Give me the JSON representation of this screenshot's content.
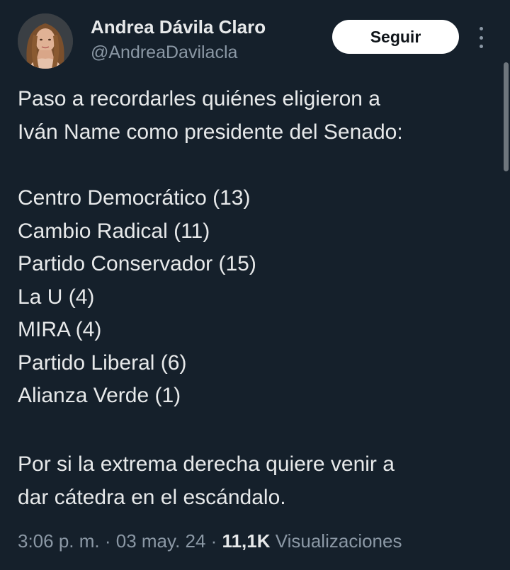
{
  "author": {
    "name": "Andrea Dávila Claro",
    "handle": "@AndreaDavilacla",
    "avatar_icon": "profile-photo"
  },
  "follow_button": {
    "label": "Seguir"
  },
  "more_icon": "more-vertical-icon",
  "tweet": {
    "intro_lines": [
      "Paso a recordarles quiénes eligieron a",
      "Iván Name como presidente del Senado:"
    ],
    "parties": [
      "Centro Democrático (13)",
      "Cambio Radical (11)",
      "Partido Conservador (15)",
      "La U (4)",
      "MIRA (4)",
      "Partido Liberal (6)",
      "Alianza Verde (1)"
    ],
    "closing_lines": [
      "Por si la extrema derecha quiere venir a",
      "dar cátedra en el escándalo."
    ]
  },
  "meta": {
    "time": "3:06 p. m.",
    "separator": " · ",
    "date": "03 may. 24",
    "views_count": "11,1K",
    "views_label": "Visualizaciones"
  },
  "colors": {
    "background": "#15202b",
    "text": "#e7e9ea",
    "secondary_text": "#8b98a5",
    "button_bg": "#ffffff",
    "button_text": "#0f1419"
  }
}
